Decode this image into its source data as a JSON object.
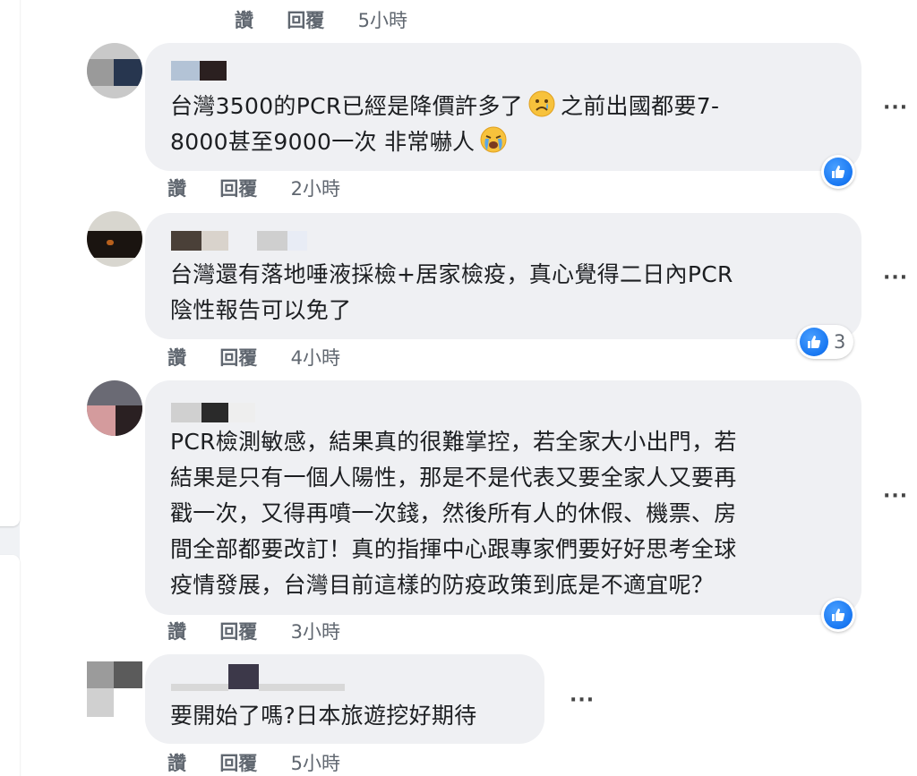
{
  "top_action": {
    "like": "讚",
    "reply": "回覆",
    "time": "5小時"
  },
  "comments": [
    {
      "text_line1": "台灣3500的PCR已經是降價許多了",
      "text_line1b": "之前出國都要7-",
      "text_line2": "8000甚至9000一次 非常嚇人",
      "emoji1": "sad-face-icon",
      "emoji2": "crying-face-icon",
      "actions": {
        "like": "讚",
        "reply": "回覆",
        "time": "2小時"
      },
      "reaction": {
        "type": "like",
        "count": ""
      }
    },
    {
      "text": "台灣還有落地唾液採檢+居家檢疫，真心覺得二日內PCR\n陰性報告可以免了",
      "actions": {
        "like": "讚",
        "reply": "回覆",
        "time": "4小時"
      },
      "reaction": {
        "type": "like",
        "count": "3"
      }
    },
    {
      "text": "PCR檢測敏感，結果真的很難掌控，若全家大小出門，若\n結果是只有一個人陽性，那是不是代表又要全家人又要再\n戳一次，又得再噴一次錢，然後所有人的休假、機票、房\n間全部都要改訂！真的指揮中心跟專家們要好好思考全球\n疫情發展，台灣目前這樣的防疫政策到底是不適宜呢？",
      "actions": {
        "like": "讚",
        "reply": "回覆",
        "time": "3小時"
      },
      "reaction": {
        "type": "like",
        "count": ""
      }
    },
    {
      "text": "要開始了嗎?日本旅遊挖好期待",
      "actions": {
        "like": "讚",
        "reply": "回覆",
        "time": "5小時"
      }
    }
  ],
  "more_label": "···",
  "colors": {
    "bubble": "#eff0f3",
    "like_blue": "#1877f2",
    "text": "#1c1e21",
    "meta": "#606770"
  }
}
